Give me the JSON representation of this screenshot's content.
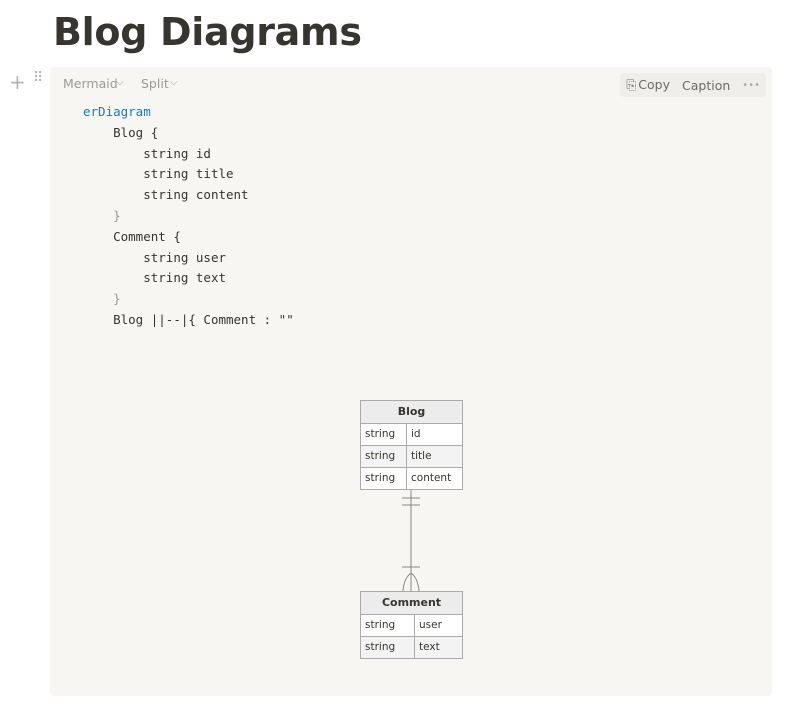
{
  "page": {
    "title": "Blog Diagrams"
  },
  "toolbar": {
    "language": "Mermaid",
    "view": "Split",
    "copy": "Copy",
    "caption": "Caption",
    "more": "•••"
  },
  "code": {
    "lines": [
      "erDiagram",
      "Blog {",
      "string id",
      "string title",
      "string content",
      "}",
      "Comment {",
      "string user",
      "string text",
      "}",
      "Blog ||--|{ Comment : \"\""
    ]
  },
  "diagram": {
    "entities": [
      {
        "name": "Blog",
        "attributes": [
          [
            "string",
            "id"
          ],
          [
            "string",
            "title"
          ],
          [
            "string",
            "content"
          ]
        ]
      },
      {
        "name": "Comment",
        "attributes": [
          [
            "string",
            "user"
          ],
          [
            "string",
            "text"
          ]
        ]
      }
    ],
    "relationship": {
      "from": "Blog",
      "to": "Comment",
      "from_cardinality": "exactly-one",
      "to_cardinality": "one-or-more",
      "label": ""
    }
  }
}
